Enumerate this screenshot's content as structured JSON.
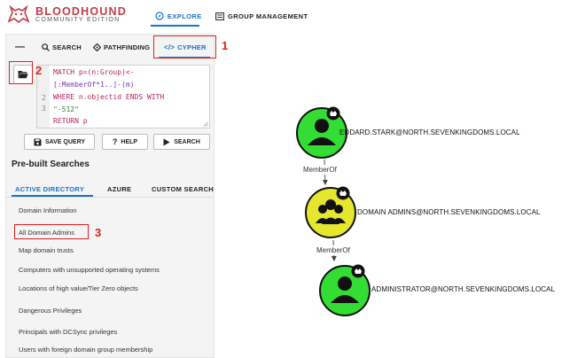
{
  "header": {
    "brand_title": "BLOODHOUND",
    "brand_subtitle": "COMMUNITY EDITION",
    "nav": [
      {
        "label": "EXPLORE",
        "icon": "compass-icon"
      },
      {
        "label": "GROUP MANAGEMENT",
        "icon": "group-management-icon"
      }
    ]
  },
  "panel": {
    "tabs": [
      {
        "label": "SEARCH",
        "icon": "search-icon"
      },
      {
        "label": "PATHFINDING",
        "icon": "pathfinding-icon"
      },
      {
        "label": "CYPHER",
        "icon": "code-icon"
      }
    ],
    "editor": {
      "line_numbers": [
        "2",
        "3"
      ],
      "lines": [
        "MATCH p=(n:Group)<-",
        "[:MemberOf*1..]-(m)",
        "WHERE n.objectid ENDS WITH",
        "\"-512\"",
        "RETURN p"
      ]
    },
    "buttons": {
      "save": "SAVE QUERY",
      "help": "HELP",
      "search": "SEARCH"
    },
    "prebuilt_title": "Pre-built Searches",
    "subtabs": [
      "ACTIVE DIRECTORY",
      "AZURE",
      "CUSTOM SEARCH"
    ],
    "queries": [
      "Domain Information",
      "All Domain Admins",
      "Map domain trusts",
      "Computers with unsupported operating systems",
      "Locations of high value/Tier Zero objects",
      "Dangerous Privileges",
      "Principals with DCSync privileges",
      "Users with foreign domain group membership"
    ]
  },
  "annotations": [
    "1",
    "2",
    "3"
  ],
  "graph": {
    "nodes": [
      {
        "label": "EDDARD.STARK@NORTH.SEVENKINGDOMS.LOCAL",
        "kind": "user",
        "color": "#33dd33"
      },
      {
        "label": "DOMAIN ADMINS@NORTH.SEVENKINGDOMS.LOCAL",
        "kind": "group",
        "color": "#e6e62e"
      },
      {
        "label": "ADMINISTRATOR@NORTH.SEVENKINGDOMS.LOCAL",
        "kind": "user",
        "color": "#33dd33"
      }
    ],
    "edges": [
      {
        "label": "MemberOf"
      },
      {
        "label": "MemberOf"
      }
    ]
  },
  "colors": {
    "accent": "#1a73c8",
    "brand": "#c23b46",
    "annotation": "#e02020",
    "user_node": "#33dd33",
    "group_node": "#e6e62e"
  }
}
